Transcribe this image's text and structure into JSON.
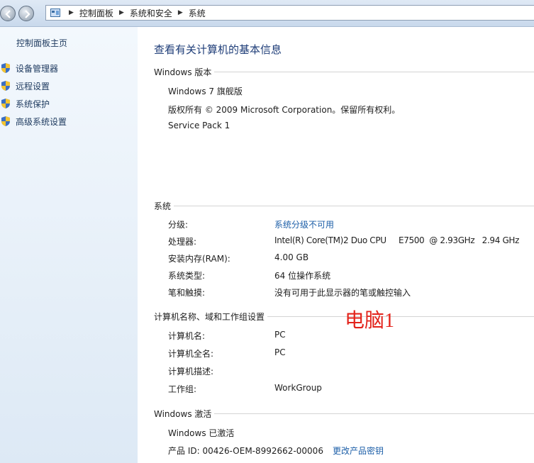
{
  "breadcrumb": [
    "控制面板",
    "系统和安全",
    "系统"
  ],
  "sidebar": {
    "home": "控制面板主页",
    "items": [
      {
        "label": "设备管理器",
        "icon": "shield-icon"
      },
      {
        "label": "远程设置",
        "icon": "shield-icon"
      },
      {
        "label": "系统保护",
        "icon": "shield-icon"
      },
      {
        "label": "高级系统设置",
        "icon": "shield-icon"
      }
    ]
  },
  "main": {
    "title": "查看有关计算机的基本信息",
    "windows_edition": {
      "header": "Windows 版本",
      "edition": "Windows 7 旗舰版",
      "copyright": "版权所有 © 2009 Microsoft Corporation。保留所有权利。",
      "service_pack": "Service Pack 1"
    },
    "system": {
      "header": "系统",
      "rows": [
        {
          "label": "分级:",
          "value": "系统分级不可用",
          "link": true
        },
        {
          "label": "处理器:",
          "value": "Intel(R) Core(TM)2 Duo CPU     E7500  @ 2.93GHz   2.94 GHz"
        },
        {
          "label": "安装内存(RAM):",
          "value": "4.00 GB"
        },
        {
          "label": "系统类型:",
          "value": "64 位操作系统"
        },
        {
          "label": "笔和触摸:",
          "value": "没有可用于此显示器的笔或触控输入"
        }
      ]
    },
    "computer": {
      "header": "计算机名称、域和工作组设置",
      "rows": [
        {
          "label": "计算机名:",
          "value": "PC"
        },
        {
          "label": "计算机全名:",
          "value": "PC"
        },
        {
          "label": "计算机描述:",
          "value": ""
        },
        {
          "label": "工作组:",
          "value": "WorkGroup"
        }
      ]
    },
    "activation": {
      "header": "Windows 激活",
      "status": "Windows 已激活",
      "product_id": "产品 ID: 00426-OEM-8992662-00006",
      "change_key": "更改产品密钥"
    },
    "annotation": "电脑1"
  },
  "colors": {
    "link": "#1d5fa8",
    "title": "#1e3d78",
    "annotation": "#e3231b"
  }
}
